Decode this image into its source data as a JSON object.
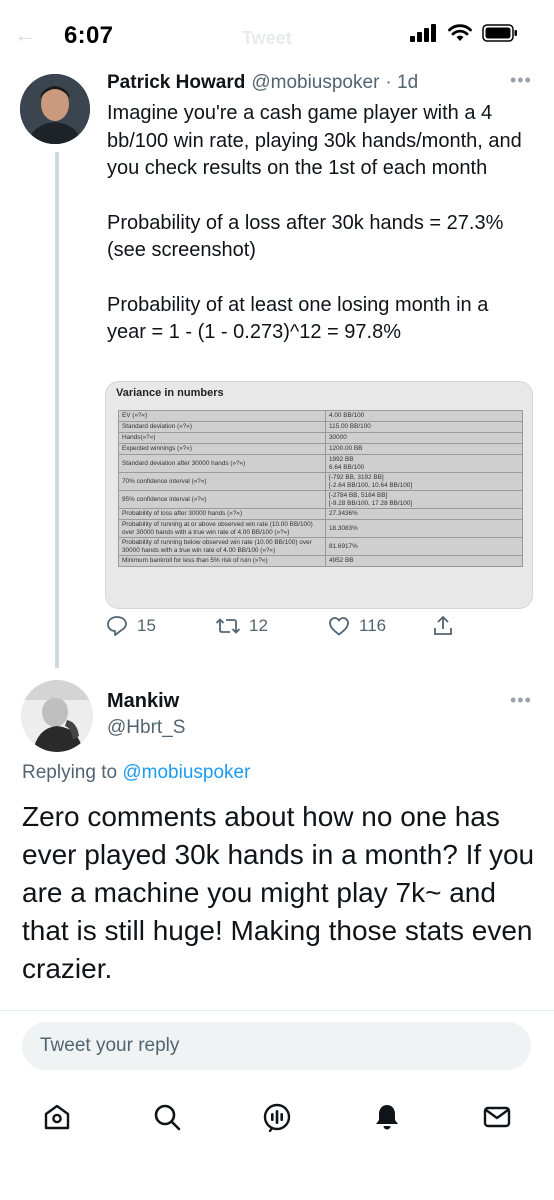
{
  "status_bar": {
    "time": "6:07"
  },
  "header": {
    "title": "Tweet"
  },
  "tweet": {
    "author_name": "Patrick Howard",
    "author_handle": "@mobiuspoker",
    "time": "· 1d",
    "paragraphs": [
      "Imagine you're a cash game player with a 4 bb/100 win rate, playing 30k hands/month, and you check results on the 1st of each month",
      "Probability of a loss after 30k hands = 27.3% (see screenshot)",
      "Probability of at least one losing month in a year = 1 - (1 - 0.273)^12 = 97.8%"
    ],
    "media": {
      "title": "Variance in numbers",
      "rows": [
        [
          "EV (»?«)",
          "4.00 BB/100"
        ],
        [
          "Standard deviation (»?«)",
          "115.00 BB/100"
        ],
        [
          "Hands(»?«)",
          "30000"
        ],
        [
          "Expected winnings (»?«)",
          "1200.00 BB"
        ],
        [
          "Standard deviation after 30000 hands (»?«)",
          "1992 BB\n6.64 BB/100"
        ],
        [
          "70% confidence interval (»?«)",
          "[-792 BB, 3192 BB]\n[-2.64 BB/100, 10.64 BB/100]"
        ],
        [
          "95% confidence interval (»?«)",
          "[-2784 BB, 5184 BB]\n[-9.28 BB/100, 17.28 BB/100]"
        ],
        [
          "Probability of loss after 30000 hands (»?«)",
          "27.3436%"
        ],
        [
          "Probability of running at or above observed win rate (10.00 BB/100) over 30000 hands with a true win rate of 4.00 BB/100 (»?«)",
          "18.3083%"
        ],
        [
          "Probability of running below observed win rate (10.00 BB/100) over 30000 hands with a true win rate of 4.00 BB/100 (»?«)",
          "81.6917%"
        ],
        [
          "Minimum bankroll for less than 5% risk of ruin (»?«)",
          "4952 BB"
        ]
      ]
    },
    "actions": {
      "replies": "15",
      "retweets": "12",
      "likes": "116"
    }
  },
  "reply": {
    "author_name": "Mankiw",
    "author_handle": "@Hbrt_S",
    "replying_prefix": "Replying to",
    "replying_to": "@mobiuspoker",
    "text": "Zero comments about how no one has ever played 30k hands in a month? If you are a machine you might play 7k~ and that is still huge! Making those stats even crazier."
  },
  "compose": {
    "placeholder": "Tweet your reply"
  },
  "nav_icons": [
    "home-icon",
    "search-icon",
    "spaces-icon",
    "notifications-icon",
    "messages-icon"
  ],
  "colors": {
    "link": "#1d9bf0",
    "secondary_text": "#536471",
    "primary_text": "#0f1419"
  }
}
